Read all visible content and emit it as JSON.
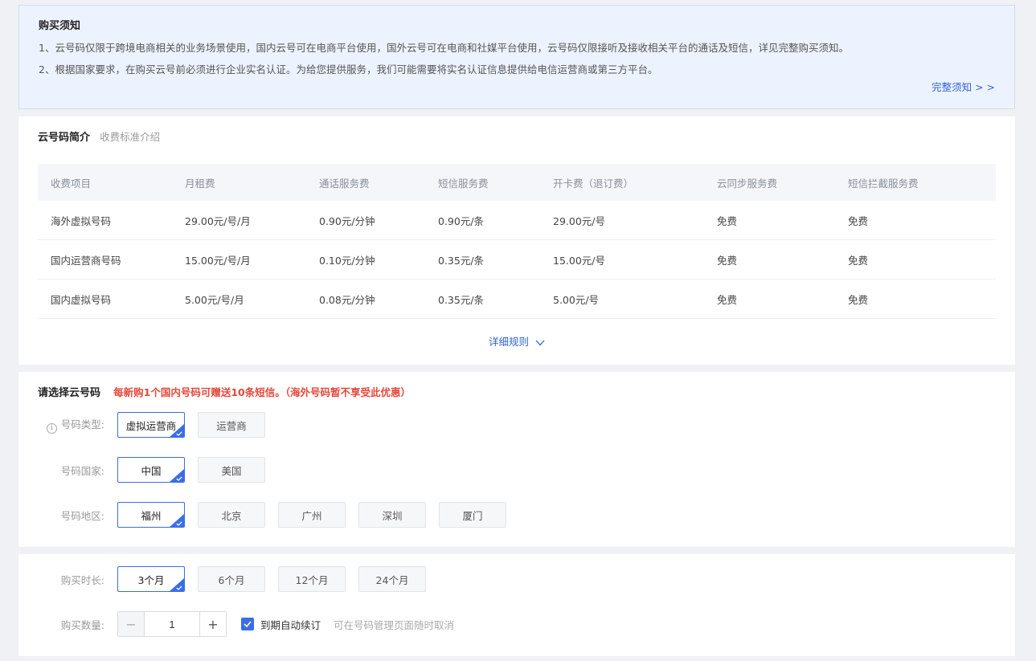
{
  "notice": {
    "title": "购买须知",
    "line1": "1、云号码仅限于跨境电商相关的业务场景使用，国内云号可在电商平台使用，国外云号可在电商和社媒平台使用，云号码仅限接听及接收相关平台的通话及短信，详见完整购买须知。",
    "line2": "2、根据国家要求，在购买云号前必须进行企业实名认证。为给您提供服务，我们可能需要将实名认证信息提供给电信运营商或第三方平台。",
    "link": "完整须知 > >"
  },
  "intro": {
    "title": "云号码简介",
    "subtitle": "收费标准介绍",
    "columns": [
      "收费项目",
      "月租费",
      "通话服务费",
      "短信服务费",
      "开卡费（退订费）",
      "云同步服务费",
      "短信拦截服务费"
    ],
    "rows": [
      [
        "海外虚拟号码",
        "29.00元/号/月",
        "0.90元/分钟",
        "0.90元/条",
        "29.00元/号",
        "免费",
        "免费"
      ],
      [
        "国内运营商号码",
        "15.00元/号/月",
        "0.10元/分钟",
        "0.35元/条",
        "15.00元/号",
        "免费",
        "免费"
      ],
      [
        "国内虚拟号码",
        "5.00元/号/月",
        "0.08元/分钟",
        "0.35元/条",
        "5.00元/号",
        "免费",
        "免费"
      ]
    ],
    "detail_link": "详细规则"
  },
  "select": {
    "title": "请选择云号码",
    "promo": "每新购1个国内号码可赠送10条短信。（海外号码暂不享受此优惠）",
    "type_label": "号码类型:",
    "type_options": [
      "虚拟运营商",
      "运营商"
    ],
    "country_label": "号码国家:",
    "country_options": [
      "中国",
      "美国"
    ],
    "region_label": "号码地区:",
    "region_options": [
      "福州",
      "北京",
      "广州",
      "深圳",
      "厦门"
    ]
  },
  "buy": {
    "duration_label": "购买时长:",
    "duration_options": [
      "3个月",
      "6个月",
      "12个月",
      "24个月"
    ],
    "quantity_label": "购买数量:",
    "quantity_value": "1",
    "minus": "−",
    "plus": "+",
    "auto_renew_label": "到期自动续订",
    "auto_renew_hint": "可在号码管理页面随时取消"
  },
  "colors": {
    "accent": "#3a6ee6",
    "link": "#2f62d9",
    "promo": "#e5483b",
    "notice_bg": "#edf3fe"
  }
}
